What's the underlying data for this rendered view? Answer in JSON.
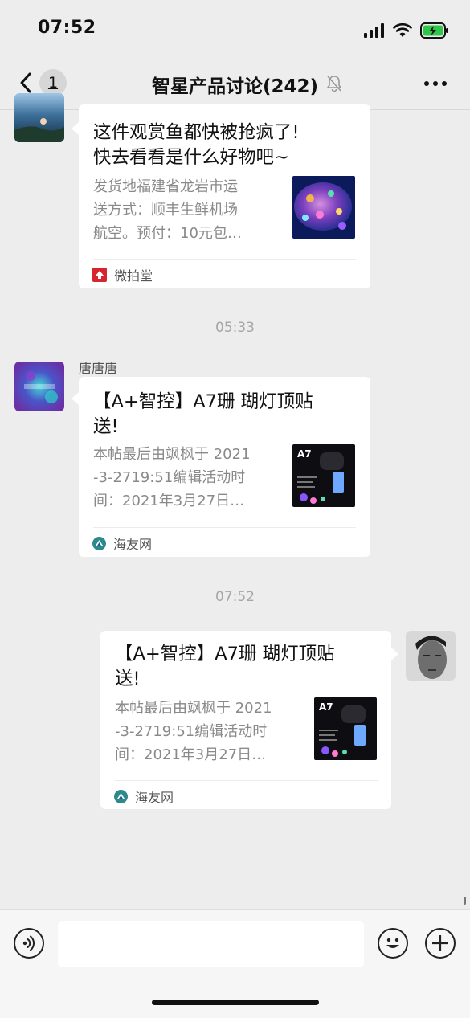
{
  "status_bar": {
    "time": "07:52"
  },
  "nav": {
    "unread_count": "1",
    "title": "智星产品讨论(242)"
  },
  "messages": [
    {
      "card": {
        "title": "这件观赏鱼都快被抢疯了!\n快去看看是什么好物吧~",
        "description": "发货地福建省龙岩市运\n送方式：顺丰生鲜机场\n航空。预付：10元包…",
        "source": "微拍堂",
        "thumb": "coral-photo"
      }
    },
    {
      "timestamp": "05:33"
    },
    {
      "sender": "唐唐唐",
      "card": {
        "title": "【A+智控】A7珊 瑚灯顶贴\n送!",
        "description": "本帖最后由飒枫于 2021\n-3-2719:51编辑活动时\n间：2021年3月27日…",
        "source": "海友网",
        "thumb_label": "A7"
      }
    },
    {
      "timestamp": "07:52"
    },
    {
      "card": {
        "title": "【A+智控】A7珊 瑚灯顶贴\n送!",
        "description": "本帖最后由飒枫于 2021\n-3-2719:51编辑活动时\n间：2021年3月27日…",
        "source": "海友网",
        "thumb_label": "A7"
      }
    }
  ],
  "input_bar": {
    "placeholder": ""
  },
  "icons": {
    "back": "chevron-left-icon",
    "mute": "bell-slash-icon",
    "more": "ellipsis-icon",
    "voice": "voice-icon",
    "emoji": "smile-icon",
    "add": "plus-icon"
  }
}
